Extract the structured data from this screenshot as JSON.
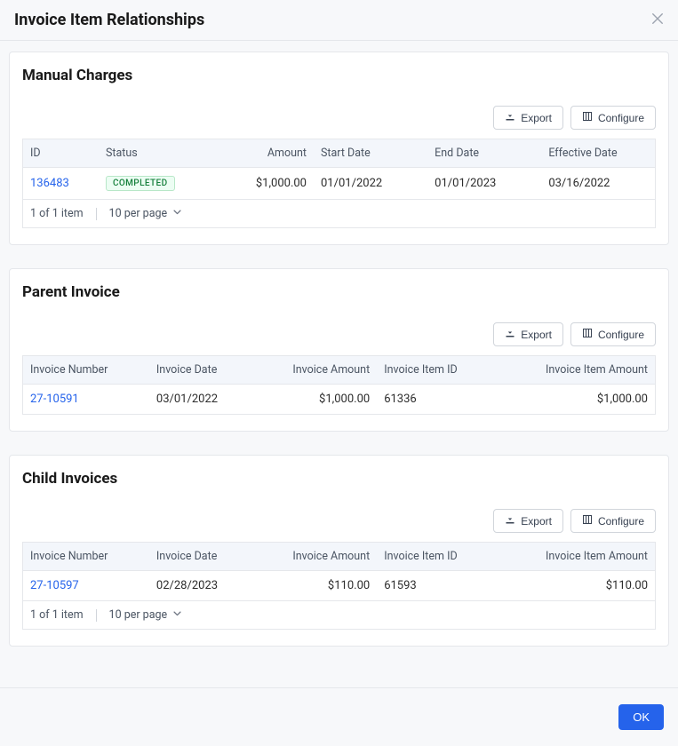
{
  "modal": {
    "title": "Invoice Item Relationships",
    "ok_label": "OK"
  },
  "common": {
    "export_label": "Export",
    "configure_label": "Configure"
  },
  "manual_charges": {
    "title": "Manual Charges",
    "columns": {
      "id": "ID",
      "status": "Status",
      "amount": "Amount",
      "start_date": "Start Date",
      "end_date": "End Date",
      "effective_date": "Effective Date"
    },
    "rows": [
      {
        "id": "136483",
        "status": "COMPLETED",
        "amount": "$1,000.00",
        "start_date": "01/01/2022",
        "end_date": "01/01/2023",
        "effective_date": "03/16/2022"
      }
    ],
    "pager": {
      "summary": "1 of 1 item",
      "per_page": "10 per page"
    }
  },
  "parent_invoice": {
    "title": "Parent Invoice",
    "columns": {
      "invoice_number": "Invoice Number",
      "invoice_date": "Invoice Date",
      "invoice_amount": "Invoice Amount",
      "invoice_item_id": "Invoice Item ID",
      "invoice_item_amount": "Invoice Item Amount"
    },
    "rows": [
      {
        "invoice_number": "27-10591",
        "invoice_date": "03/01/2022",
        "invoice_amount": "$1,000.00",
        "invoice_item_id": "61336",
        "invoice_item_amount": "$1,000.00"
      }
    ]
  },
  "child_invoices": {
    "title": "Child Invoices",
    "columns": {
      "invoice_number": "Invoice Number",
      "invoice_date": "Invoice Date",
      "invoice_amount": "Invoice Amount",
      "invoice_item_id": "Invoice Item ID",
      "invoice_item_amount": "Invoice Item Amount"
    },
    "rows": [
      {
        "invoice_number": "27-10597",
        "invoice_date": "02/28/2023",
        "invoice_amount": "$110.00",
        "invoice_item_id": "61593",
        "invoice_item_amount": "$110.00"
      }
    ],
    "pager": {
      "summary": "1 of 1 item",
      "per_page": "10 per page"
    }
  }
}
